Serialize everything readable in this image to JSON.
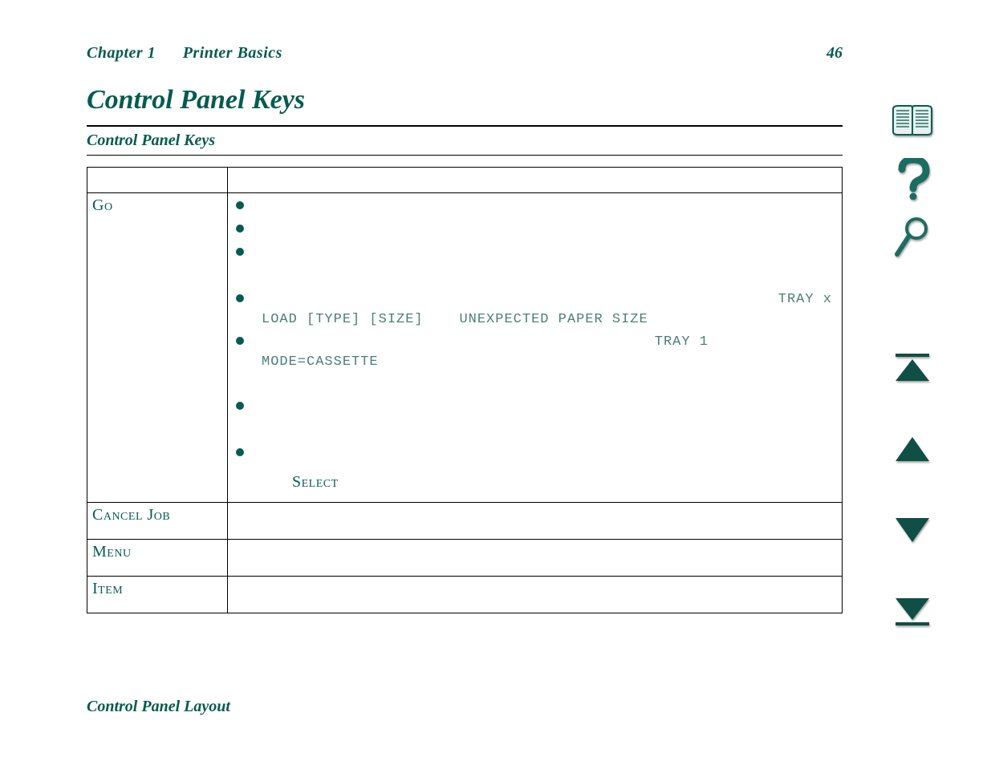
{
  "header": {
    "chapter": "Chapter 1",
    "section": "Printer Basics",
    "page_number": "46"
  },
  "title": "Control Panel Keys",
  "subhead": "Control Panel Keys",
  "footer": "Control Panel Layout",
  "keys": {
    "go": "Go",
    "cancel_job": "Cancel Job",
    "menu": "Menu",
    "item": "Item"
  },
  "go_content": {
    "tray_x": "TRAY x",
    "line_load": "LOAD [TYPE] [SIZE]",
    "line_unexpected": "UNEXPECTED PAPER SIZE",
    "tray_1": "TRAY 1",
    "mode_cassette": "MODE=CASSETTE",
    "select": "Select"
  },
  "nav": {
    "book": "book-icon",
    "help": "help-icon",
    "search": "search-icon",
    "first": "go-first-icon",
    "prev": "go-prev-icon",
    "next": "go-next-icon",
    "last": "go-last-icon"
  }
}
